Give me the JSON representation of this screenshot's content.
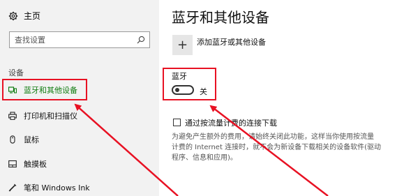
{
  "sidebar": {
    "home_label": "主页",
    "search_placeholder": "查找设置",
    "section_label": "设备",
    "items": [
      {
        "label": "蓝牙和其他设备",
        "icon": "bluetooth-devices-icon",
        "active": true
      },
      {
        "label": "打印机和扫描仪",
        "icon": "printer-icon",
        "active": false
      },
      {
        "label": "鼠标",
        "icon": "mouse-icon",
        "active": false
      },
      {
        "label": "触摸板",
        "icon": "touchpad-icon",
        "active": false
      },
      {
        "label": "笔和 Windows Ink",
        "icon": "pen-icon",
        "active": false
      }
    ]
  },
  "main": {
    "title": "蓝牙和其他设备",
    "add_device_label": "添加蓝牙或其他设备",
    "bluetooth_label": "蓝牙",
    "bluetooth_state": "关",
    "bluetooth_on": false,
    "metered_label": "通过按流量计费的连接下载",
    "metered_checked": false,
    "description_lines": [
      "为避免产生额外的费用，请始终关闭此功能，这样当你使用按流量",
      "计费的 Internet 连接时，就不会为新设备下载相关的设备软件(驱动",
      "程序、信息和应用)。"
    ]
  },
  "colors": {
    "accent": "#107c10",
    "highlight": "#e81123",
    "sidebar_bg": "#f2f2f2"
  }
}
